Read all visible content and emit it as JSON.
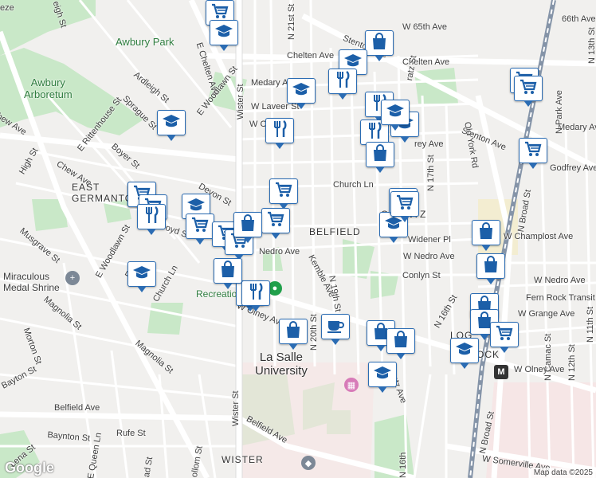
{
  "labels": {
    "awbury_park": "Awbury Park",
    "awbury_arboretum": "Awbury\nArboretum",
    "breeze": "eze",
    "eleigh": "eigh St",
    "chelten_w": "Chelten Ave",
    "chelten_e": "Chelten Ave",
    "e_chelten": "E Chelten Ave",
    "w_65th": "W 65th Ave",
    "w_66th": "66th Ave",
    "stenton_top": "Stenton Ave",
    "stenton_right": "Stenton Ave",
    "medary_w": "Medary Ave",
    "medary_e": "Medary Ave",
    "w_laveer": "W Laveer St",
    "w_cliveden": "W C",
    "ardleigh": "Ardleigh St",
    "sprague": "Sprague St",
    "e_woodlawn": "E Woodlawn St",
    "e_rittenhouse": "E Rittenhouse St",
    "boyer": "Boyer St",
    "chew_top": "hew Ave",
    "chew_mid": "Chew Ave",
    "high": "High St",
    "wister_top": "Wister St",
    "wister_bottom": "Wister St",
    "n21st": "N 21st St",
    "devon": "Devon St",
    "church_ln_n": "Church Ln",
    "church_ln_s": "Church Ln",
    "belfield_hood": "BELFIELD",
    "east_germantown": "EAST\nGERMANTO",
    "ogontz": "OGONTZ",
    "nedro_w": "Nedro Ave",
    "w_nedro": "W Nedro Ave",
    "w_nedro2": "W Nedro Ave",
    "kemble": "Kemble Ave",
    "conlyn": "Conlyn St",
    "widener": "Widener Pl",
    "w_champlost": "W Champlost Ave",
    "w_grange": "W Grange Ave",
    "w_olney_w": "W Olney Ave",
    "w_olney_e": "W Olney Ave",
    "n20th": "N 20th St",
    "n19th": "N 19th St",
    "n17th": "N 17th St",
    "n16th": "N 16th St",
    "n16th_b": "N 16th",
    "n13th": "N 13th St",
    "n12th": "N 12th St",
    "n11th": "N 11th St",
    "n_broad": "N Broad St",
    "n_broad_b": "N Broad St",
    "old_york": "Old York Rd",
    "n_park": "N Park Ave",
    "n_camac": "N Camac St",
    "godfrey": "Godfrey Ave",
    "fern_rock": "Fern Rock Transit",
    "logan": "LOG",
    "fern": "FE",
    "rock": "OCK",
    "miraculous": "Miraculous\nMedal Shrine",
    "musgrave": "Musgrave St",
    "e_woodlawn2": "E Woodlawn St",
    "magnolia_w": "Magnolia St",
    "magnolia_e": "Magnolia St",
    "morton": "Morton St",
    "bayton_w": "Bayton St",
    "bayton_s": "Baynton St",
    "belfield_ave_w": "Belfield Ave",
    "belfield_ave_e": "Belfield Ave",
    "rufe": "Rufe St",
    "lena": "Lena St",
    "e_queen": "E Queen Ln",
    "haines": "ad St",
    "mollom": "ollom St",
    "wister_hood": "WISTER",
    "la_salle": "La Salle\nUniversity",
    "recreation": "Recreation C",
    "w_somerville": "W Somerville Ave",
    "pratt": "ratz St",
    "ogontz_ave": "ntz Ave",
    "ley_ave": "rey Ave",
    "e_l": "E L",
    "oyd": "oyd S",
    "w_65_short": "W 65",
    "n19th_b": "N 19th"
  },
  "pins": [
    {
      "icon": "cart-icon",
      "kind": "grocery"
    },
    {
      "icon": "school-icon",
      "kind": "school"
    },
    {
      "icon": "bag-icon",
      "kind": "shopping"
    },
    {
      "icon": "school-icon",
      "kind": "school"
    },
    {
      "icon": "school-icon",
      "kind": "school"
    },
    {
      "icon": "restaurant-icon",
      "kind": "restaurant"
    },
    {
      "icon": "school-icon",
      "kind": "school"
    },
    {
      "icon": "restaurant-icon",
      "kind": "restaurant"
    },
    {
      "icon": "school-icon",
      "kind": "school"
    },
    {
      "icon": "restaurant-icon",
      "kind": "restaurant"
    },
    {
      "icon": "restaurant-icon",
      "kind": "restaurant"
    },
    {
      "icon": "school-icon",
      "kind": "school"
    },
    {
      "icon": "bag-icon",
      "kind": "shopping"
    },
    {
      "icon": "cart-icon",
      "kind": "grocery"
    },
    {
      "icon": "cart-icon",
      "kind": "grocery"
    },
    {
      "icon": "cart-icon",
      "kind": "grocery"
    },
    {
      "icon": "school-icon",
      "kind": "school"
    },
    {
      "icon": "cart-icon",
      "kind": "grocery"
    },
    {
      "icon": "restaurant-icon",
      "kind": "restaurant"
    },
    {
      "icon": "school-icon",
      "kind": "school"
    },
    {
      "icon": "cart-icon",
      "kind": "grocery"
    },
    {
      "icon": "cart-icon",
      "kind": "grocery"
    },
    {
      "icon": "restaurant-icon",
      "kind": "restaurant"
    },
    {
      "icon": "cart-icon",
      "kind": "grocery"
    },
    {
      "icon": "bag-icon",
      "kind": "shopping"
    },
    {
      "icon": "cart-icon",
      "kind": "grocery"
    },
    {
      "icon": "cart-icon",
      "kind": "grocery"
    },
    {
      "icon": "cart-icon",
      "kind": "grocery"
    },
    {
      "icon": "school-icon",
      "kind": "school"
    },
    {
      "icon": "bag-icon",
      "kind": "shopping"
    },
    {
      "icon": "bag-icon",
      "kind": "shopping"
    },
    {
      "icon": "bag-icon",
      "kind": "shopping"
    },
    {
      "icon": "restaurant-icon",
      "kind": "restaurant"
    },
    {
      "icon": "bag-icon",
      "kind": "shopping"
    },
    {
      "icon": "cafe-icon",
      "kind": "cafe"
    },
    {
      "icon": "bag-icon",
      "kind": "shopping"
    },
    {
      "icon": "bag-icon",
      "kind": "shopping"
    },
    {
      "icon": "bag-icon",
      "kind": "shopping"
    },
    {
      "icon": "bag-icon",
      "kind": "shopping"
    },
    {
      "icon": "cart-icon",
      "kind": "grocery"
    },
    {
      "icon": "school-icon",
      "kind": "school"
    },
    {
      "icon": "school-icon",
      "kind": "school"
    },
    {
      "icon": "school-icon",
      "kind": "school"
    },
    {
      "icon": "cart-icon",
      "kind": "grocery"
    },
    {
      "icon": "cart-icon",
      "kind": "grocery"
    }
  ],
  "google_logo": "Google",
  "attribution": "Map data ©2025",
  "metro_badge": "M",
  "colors": {
    "park": "#c9e8c8",
    "road_major": "#ffffff",
    "road_minor": "#ffffff",
    "rail": "#8594a8",
    "pin_border": "#2b6cb3",
    "pin_icon": "#1c5fa8",
    "university": "#fdf0f0"
  }
}
